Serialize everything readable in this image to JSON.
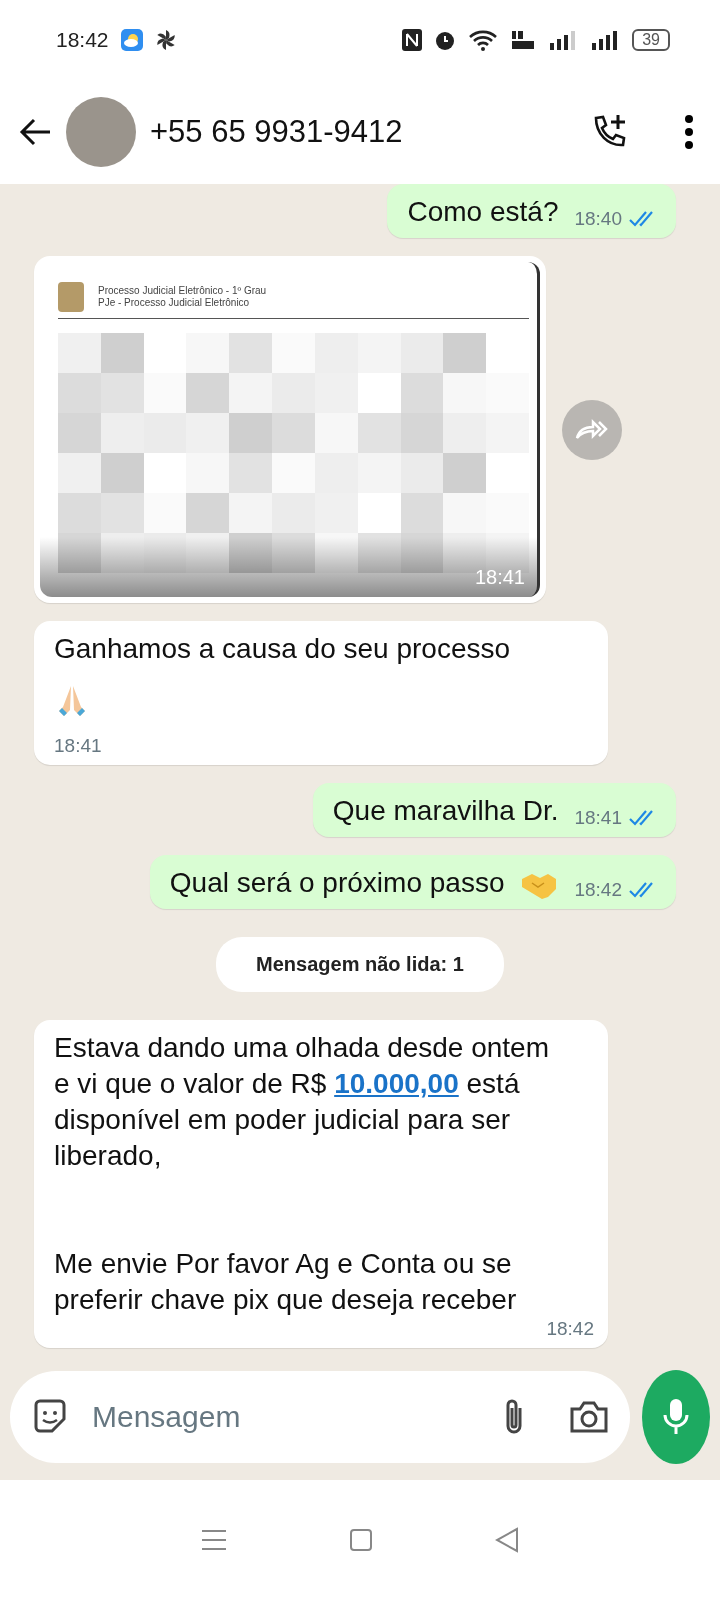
{
  "status_bar": {
    "time": "18:42",
    "battery": "39"
  },
  "header": {
    "title": "+55 65 9931-9412"
  },
  "messages": [
    {
      "kind": "text",
      "outgoing": true,
      "text": "Como está?",
      "time": "18:40",
      "read": true
    },
    {
      "kind": "document",
      "outgoing": false,
      "header_lines": [
        "Processo Judicial Eletrônico - 1º Grau",
        "PJe - Processo Judicial Eletrônico"
      ],
      "time": "18:41"
    },
    {
      "kind": "text",
      "outgoing": false,
      "text": "Ganhamos a causa do seu processo",
      "with_praying_hands": true,
      "time": "18:41"
    },
    {
      "kind": "text",
      "outgoing": true,
      "text": "Que maravilha Dr.",
      "time": "18:41",
      "read": true
    },
    {
      "kind": "text",
      "outgoing": true,
      "text": "Qual será o próximo passo",
      "with_handshake": true,
      "time": "18:42",
      "read": true
    },
    {
      "kind": "unread",
      "text": "Mensagem não lida: 1"
    },
    {
      "kind": "long",
      "outgoing": false,
      "paragraphs": [
        {
          "before": "Estava dando uma olhada desde ontem e vi que o valor de R$ ",
          "link": "10.000,00",
          "after": " está disponível em poder judicial para ser liberado,"
        },
        {
          "before": "Me envie Por favor Ag e Conta ou se preferir chave pix que deseja receber"
        }
      ],
      "time": "18:42"
    }
  ],
  "composer": {
    "placeholder": "Mensagem"
  }
}
